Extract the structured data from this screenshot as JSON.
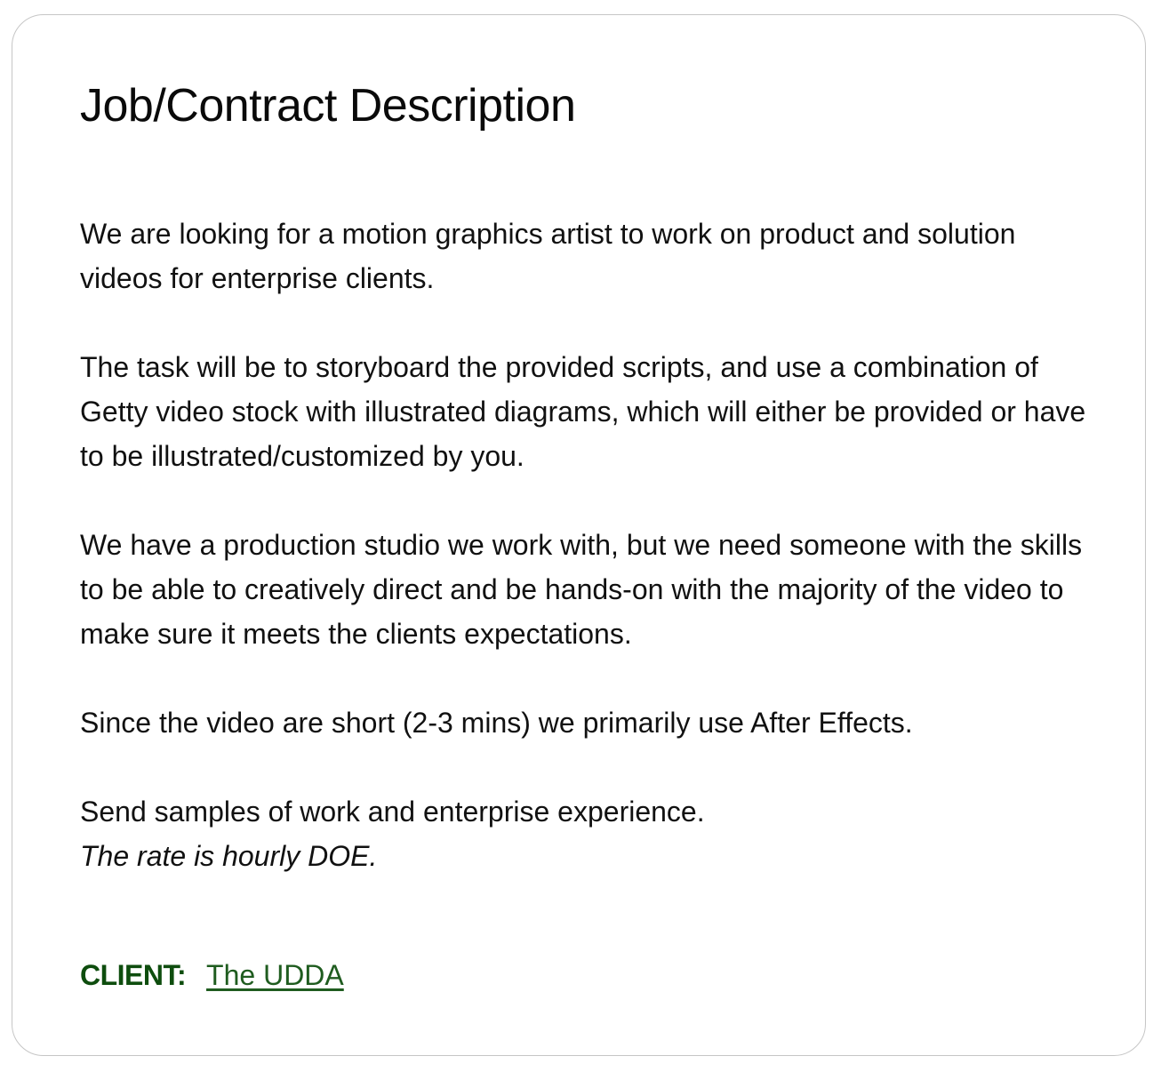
{
  "card": {
    "title": "Job/Contract Description",
    "paragraphs": {
      "p1": "We are looking for a motion graphics artist to work on product and solution videos for enterprise clients.",
      "p2": "The task will be to storyboard the provided scripts, and use a combination of Getty video stock with illustrated diagrams, which will either be provided or have to be illustrated/customized by you.",
      "p3": "We have a production studio we work with, but we need someone with the skills to be able to creatively direct and be hands-on with the majority of the video to make sure it meets the clients expectations.",
      "p4": "Since the video are short (2-3 mins) we primarily use After Effects.",
      "p5": "Send samples of work and enterprise experience.",
      "p5_italic": "The rate is hourly DOE."
    },
    "client": {
      "label": "CLIENT:",
      "link_text": "The UDDA"
    }
  },
  "colors": {
    "client_label": "#0e4d0e",
    "client_link": "#1f5c1f",
    "border": "#c6c6c6",
    "text": "#111111"
  }
}
